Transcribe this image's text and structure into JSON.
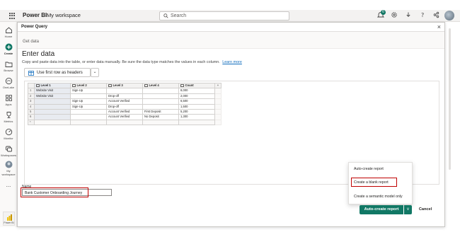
{
  "topbar": {
    "app_name": "Power BI",
    "workspace": "My workspace",
    "search_placeholder": "Search",
    "notification_count": "6"
  },
  "leftnav": {
    "items": [
      {
        "label": "Home",
        "icon": "home-icon"
      },
      {
        "label": "Create",
        "icon": "plus-icon"
      },
      {
        "label": "Browse",
        "icon": "folder-icon"
      },
      {
        "label": "OneLake",
        "icon": "onelake-icon"
      },
      {
        "label": "Apps",
        "icon": "apps-icon"
      },
      {
        "label": "Metrics",
        "icon": "trophy-icon"
      },
      {
        "label": "Monitor",
        "icon": "monitor-icon"
      },
      {
        "label": "Workspaces",
        "icon": "workspaces-icon"
      },
      {
        "label": "My workspace",
        "icon": "workspace-avatar-icon"
      }
    ],
    "more": "...",
    "bottom_tile": "Power BI"
  },
  "dialog": {
    "title": "Power Query",
    "breadcrumb": "Get data",
    "heading": "Enter data",
    "description": "Copy and paste data into the table, or enter data manually. Be sure the data type matches the values in each column.",
    "learn_more": "Learn more",
    "header_option": "Use first row as headers"
  },
  "table": {
    "columns": [
      "Level 1",
      "Level 2",
      "Level 3",
      "Level 4",
      "Count"
    ],
    "add_column": "+",
    "rows": [
      {
        "n": "1",
        "cells": [
          "Website Visit",
          "Sign-Up",
          "",
          "",
          "8,000"
        ]
      },
      {
        "n": "2",
        "cells": [
          "Website Visit",
          "",
          "Drop-off",
          "",
          "2,000"
        ]
      },
      {
        "n": "3",
        "cells": [
          "",
          "Sign-Up",
          "Account Verified",
          "",
          "6,500"
        ]
      },
      {
        "n": "4",
        "cells": [
          "",
          "Sign-Up",
          "Drop-off",
          "",
          "1,500"
        ]
      },
      {
        "n": "5",
        "cells": [
          "",
          "",
          "Account Verified",
          "First Deposit",
          "5,200"
        ]
      },
      {
        "n": "6",
        "cells": [
          "",
          "",
          "Account Verified",
          "No Deposit",
          "1,300"
        ]
      }
    ],
    "add_row": "*"
  },
  "name_field": {
    "label": "Name",
    "value": "Bank Customer Onboarding Journey"
  },
  "menu": {
    "items": [
      "Auto-create report",
      "Create a blank report",
      "Create a semantic model only"
    ]
  },
  "footer": {
    "primary": "Auto-create report",
    "split": "v",
    "cancel": "Cancel"
  },
  "colors": {
    "accent": "#117865",
    "highlight": "#c00000",
    "link": "#0f6cbd"
  }
}
